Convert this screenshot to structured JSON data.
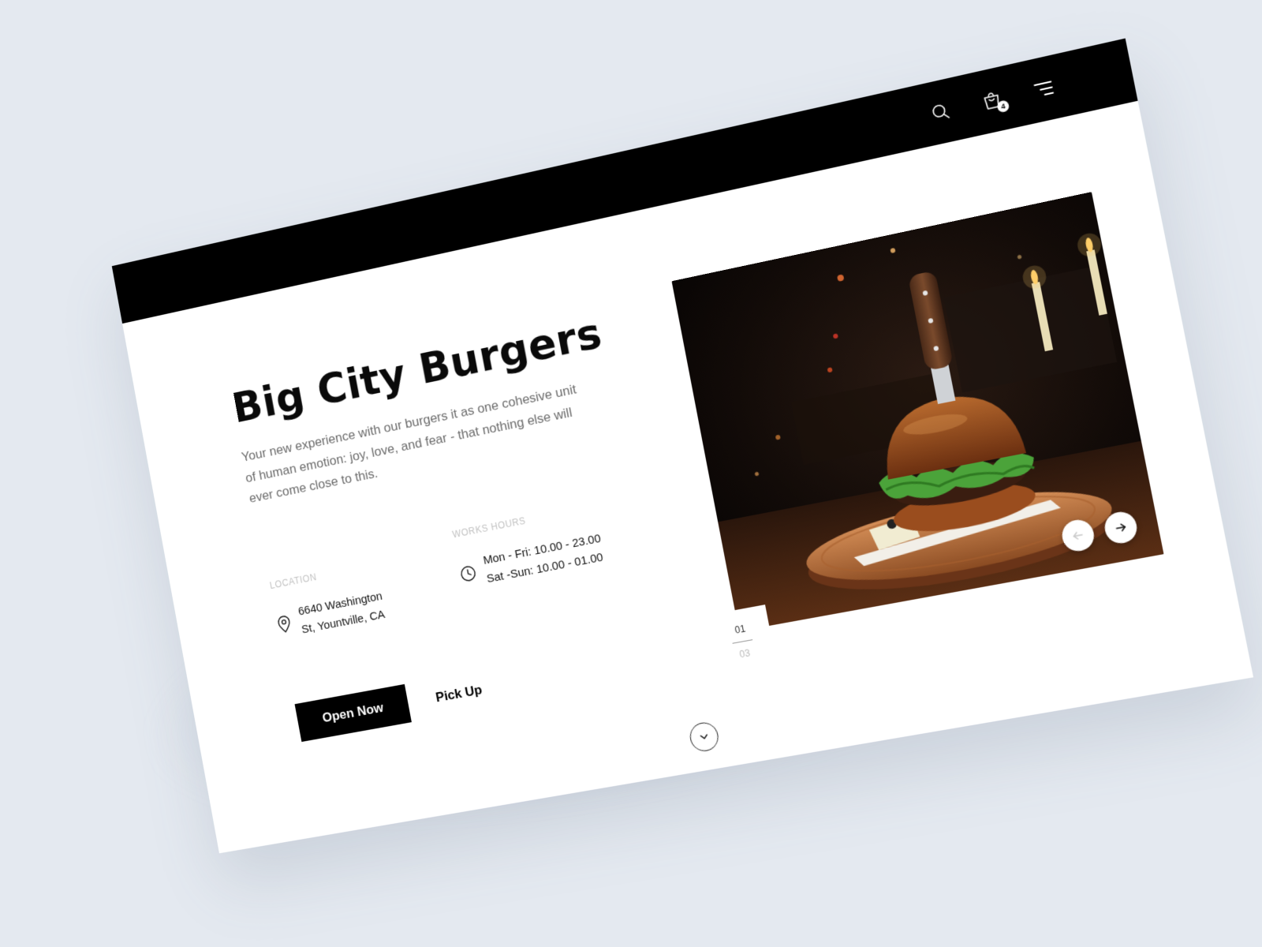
{
  "header": {
    "cart_count": "4",
    "icons": [
      "search-icon",
      "cart-icon",
      "menu-icon"
    ]
  },
  "hero": {
    "title": "Big City Burgers",
    "description": "Your new experience  with our burgers it as one cohesive unit of human emotion: joy, love, and fear - that nothing else will ever come close to this."
  },
  "location": {
    "label": "LOCATION",
    "line1": "6640 Washington",
    "line2": "St, Yountville, CA"
  },
  "hours": {
    "label": "WORKS HOURS",
    "line1": "Mon - Fri: 10.00 - 23.00",
    "line2": "Sat -Sun: 10.00 - 01.00"
  },
  "actions": {
    "primary": "Open Now",
    "secondary": "Pick Up"
  },
  "slider": {
    "current": "01",
    "total": "03"
  },
  "colors": {
    "background": "#e4e9f0",
    "topbar": "#000000",
    "page": "#ffffff",
    "muted_text": "#6b6b6b",
    "label_text": "#c2c2c2"
  }
}
